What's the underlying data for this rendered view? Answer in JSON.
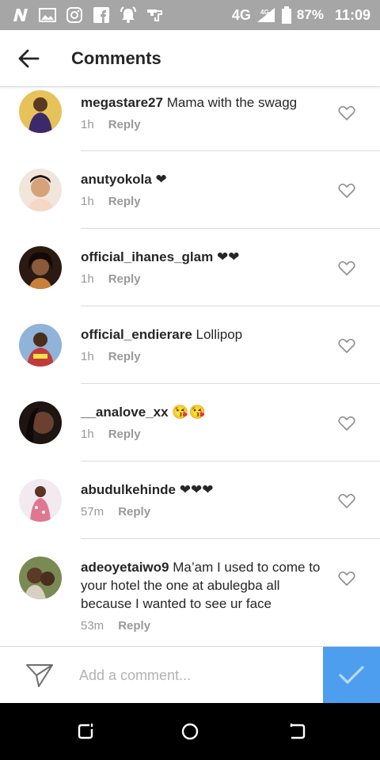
{
  "status_bar": {
    "network": "4G",
    "network_small": "4G",
    "battery_percent": "87%",
    "time": "11:09",
    "icons": [
      "n-notification-icon",
      "image-icon",
      "instagram-icon",
      "facebook-icon",
      "alarm-icon",
      "mouse-icon",
      "signal-icon",
      "battery-icon"
    ]
  },
  "header": {
    "title": "Comments",
    "back_icon": "arrow-left-icon"
  },
  "comments": [
    {
      "username": "megastare27",
      "text": "Mama with the swagg",
      "time": "1h",
      "reply": "Reply",
      "avatar_color": "#b68a3c"
    },
    {
      "username": "anutyokola",
      "text": "❤",
      "time": "1h",
      "reply": "Reply",
      "avatar_color": "#e9c9a3"
    },
    {
      "username": "official_ihanes_glam",
      "text": "❤❤",
      "time": "1h",
      "reply": "Reply",
      "avatar_color": "#4a2a1a"
    },
    {
      "username": "official_endierare",
      "text": "Lollipop",
      "time": "1h",
      "reply": "Reply",
      "avatar_color": "#3b4f7a"
    },
    {
      "username": "__analove_xx",
      "text": "😘😘",
      "time": "1h",
      "reply": "Reply",
      "avatar_color": "#3a2b24"
    },
    {
      "username": "abudulkehinde",
      "text": "❤❤❤",
      "time": "57m",
      "reply": "Reply",
      "avatar_color": "#d9a6b3"
    },
    {
      "username": "adeoyetaiwo9",
      "text": "Ma’am I used to come to your hotel the one at abulegba all because I wanted to see ur face",
      "time": "53m",
      "reply": "Reply",
      "avatar_color": "#6b5a3a"
    }
  ],
  "composer": {
    "placeholder": "Add a comment...",
    "send_icon": "paper-plane-icon",
    "post_icon": "checkmark-icon",
    "post_color": "#4e9ef0"
  },
  "nav_bar": {
    "icons": [
      "recent-apps-icon",
      "home-icon",
      "back-icon"
    ]
  }
}
